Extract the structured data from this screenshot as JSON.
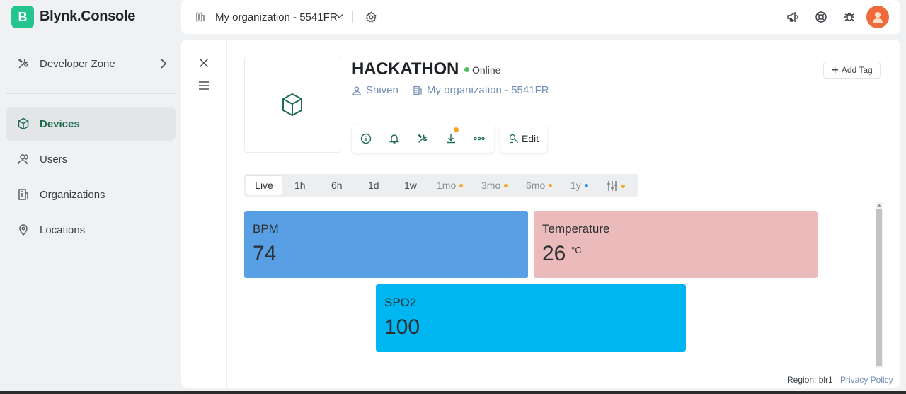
{
  "app": {
    "logo_letter": "B",
    "name": "Blynk.Console"
  },
  "sidebar": {
    "items": [
      {
        "label": "Developer Zone",
        "icon": "tools-icon"
      },
      {
        "label": "Devices",
        "icon": "cube-icon",
        "active": true
      },
      {
        "label": "Users",
        "icon": "users-icon"
      },
      {
        "label": "Organizations",
        "icon": "building-icon"
      },
      {
        "label": "Locations",
        "icon": "map-pin-icon"
      }
    ]
  },
  "topbar": {
    "organization": "My organization - 5541FR",
    "icons": [
      "megaphone-icon",
      "lifebuoy-icon",
      "bug-icon",
      "avatar"
    ]
  },
  "device": {
    "name": "HACKATHON",
    "status": "Online",
    "owner": "Shiven",
    "organization": "My organization - 5541FR",
    "add_tag": "Add Tag",
    "edit": "Edit"
  },
  "time_ranges": [
    {
      "label": "Live",
      "active": true
    },
    {
      "label": "1h"
    },
    {
      "label": "6h"
    },
    {
      "label": "1d"
    },
    {
      "label": "1w"
    },
    {
      "label": "1mo",
      "dot": "#f5a623"
    },
    {
      "label": "3mo",
      "dot": "#f5a623"
    },
    {
      "label": "6mo",
      "dot": "#f5a623"
    },
    {
      "label": "1y",
      "dot": "#3b8fd9"
    }
  ],
  "widgets": {
    "bpm": {
      "label": "BPM",
      "value": "74",
      "color": "#58a0e3"
    },
    "temperature": {
      "label": "Temperature",
      "value": "26",
      "unit": "°C",
      "color": "#ebbbbb"
    },
    "spo2": {
      "label": "SPO2",
      "value": "100",
      "color": "#00b6f0"
    }
  },
  "footer": {
    "region": "Region: blr1",
    "privacy": "Privacy Policy"
  },
  "colors": {
    "brand": "#23c48e",
    "accent": "#1f6b52",
    "link": "#6f8db5"
  }
}
